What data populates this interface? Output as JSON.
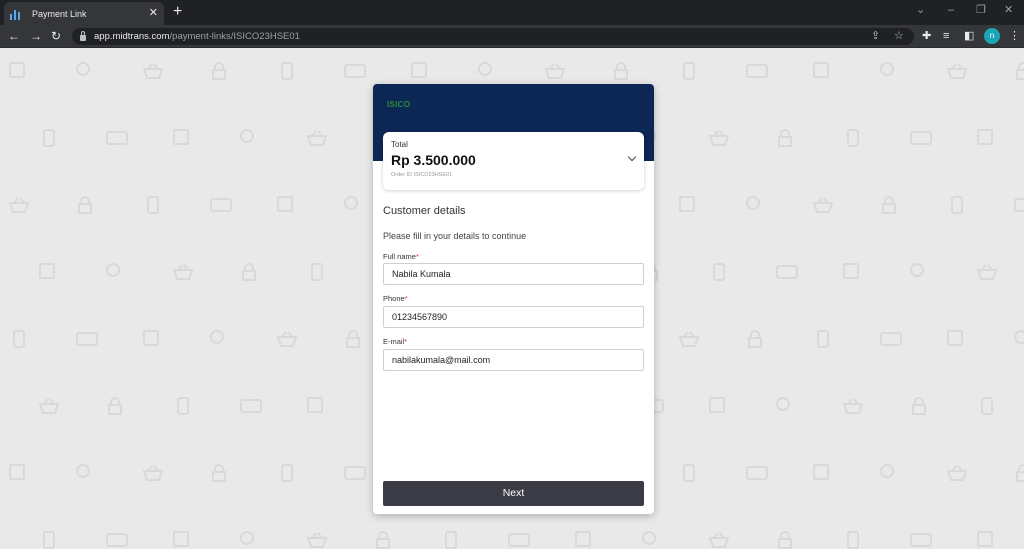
{
  "browser": {
    "tab_title": "Payment Link",
    "url_host": "app.midtrans.com",
    "url_path": "/payment-links/ISICO23HSE01",
    "profile_initial": "n"
  },
  "merchant": {
    "logo_text": "ISICO"
  },
  "summary": {
    "total_label": "Total",
    "total_amount": "Rp 3.500.000",
    "order_id": "Order ID ISICO23HSE01"
  },
  "form": {
    "title": "Customer details",
    "subtitle": "Please fill in your details to continue",
    "fields": [
      {
        "label": "Full name",
        "required_mark": "*",
        "value": "Nabila Kumala"
      },
      {
        "label": "Phone",
        "required_mark": "*",
        "value": "01234567890"
      },
      {
        "label": "E-mail",
        "required_mark": "*",
        "value": "nabilakumala@mail.com"
      }
    ],
    "next_label": "Next"
  },
  "colors": {
    "header_bg": "#0c2754",
    "button_bg": "#3a3b44",
    "required": "#d33333",
    "logo": "#2e8b3a"
  },
  "icons": [
    "back-icon",
    "forward-icon",
    "reload-icon",
    "lock-icon",
    "share-icon",
    "star-icon",
    "extensions-icon",
    "reading-list-icon",
    "side-panel-icon",
    "menu-icon",
    "chevron-down-icon"
  ]
}
